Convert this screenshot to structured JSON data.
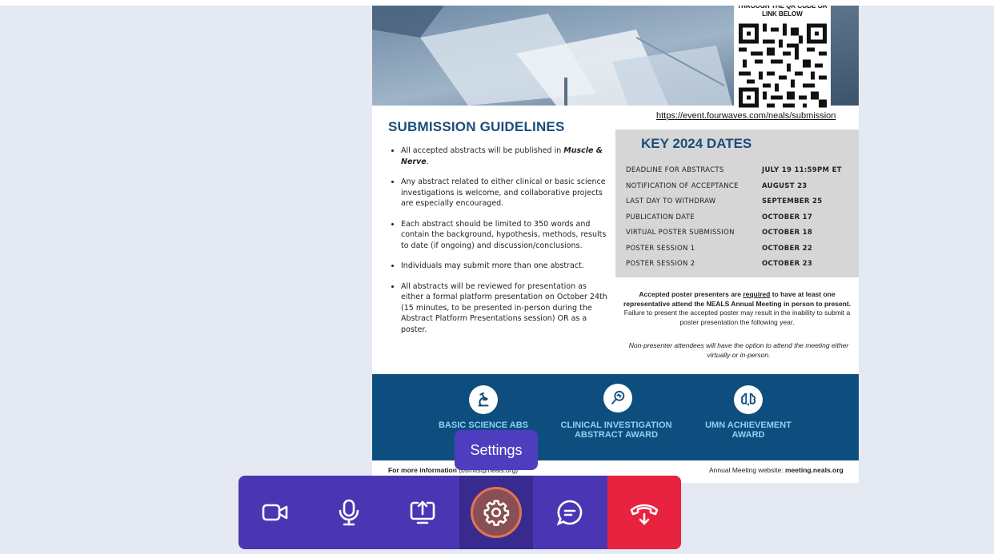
{
  "flyer": {
    "qr_caption": "THROUGH THE QR CODE OR LINK BELOW",
    "submission_link": "https://event.fourwaves.com/neals/submission",
    "guidelines_title": "SUBMISSION GUIDELINES",
    "guidelines": [
      {
        "text": "All accepted abstracts will be published in ",
        "emphasis": "Muscle & Nerve",
        "after": "."
      },
      {
        "text": "Any abstract related to either clinical or basic science investigations is welcome, and collaborative projects are especially encouraged."
      },
      {
        "text": "Each abstract should be limited to 350 words and contain the background, hypothesis, methods, results to date (if ongoing) and discussion/conclusions."
      },
      {
        "text": "Individuals may submit more than one abstract."
      },
      {
        "text": "All abstracts will be reviewed for presentation as either a formal platform presentation on October 24th (15 minutes, to be presented in-person during the Abstract Platform Presentations session) OR as a poster."
      }
    ],
    "dates_title": "KEY 2024 DATES",
    "dates": [
      {
        "label": "DEADLINE FOR ABSTRACTS",
        "value": "JULY 19 11:59PM ET"
      },
      {
        "label": "NOTIFICATION OF ACCEPTANCE",
        "value": "AUGUST 23"
      },
      {
        "label": "LAST DAY TO WITHDRAW",
        "value": "SEPTEMBER 25"
      },
      {
        "label": "PUBLICATION DATE",
        "value": "OCTOBER 17"
      },
      {
        "label": "VIRTUAL POSTER SUBMISSION",
        "value": "OCTOBER 18"
      },
      {
        "label": "POSTER SESSION 1",
        "value": "OCTOBER 22"
      },
      {
        "label": "POSTER SESSION 2",
        "value": "OCTOBER 23"
      }
    ],
    "poster_note_bold": "Accepted poster presenters are ",
    "poster_note_required": "required",
    "poster_note_bold2": " to have at least one representative attend the NEALS Annual Meeting in person to present.",
    "poster_note_rest": " Failure to present the accepted poster may result in the inability to submit a poster presentation the following year.",
    "non_presenter_note": "Non-presenter attendees will have the option to attend the meeting either virtually or in-person.",
    "awards": [
      {
        "label": "BASIC SCIENCE ABS",
        "icon": "microscope-icon"
      },
      {
        "label": "CLINICAL INVESTIGATION ABSTRACT AWARD",
        "icon": "magnifier-icon"
      },
      {
        "label": "UMN ACHIEVEMENT AWARD",
        "icon": "brain-icon"
      }
    ],
    "footer_left_prefix": "For more information",
    "footer_left_suffix": "(bsmits@neals.org)",
    "footer_right_prefix": "Annual Meeting website: ",
    "footer_right_site": "meeting.neals.org"
  },
  "tooltip": "Settings",
  "toolbar": {
    "buttons": [
      {
        "name": "camera",
        "icon": "video-camera-icon"
      },
      {
        "name": "microphone",
        "icon": "microphone-icon"
      },
      {
        "name": "share-screen",
        "icon": "screen-share-icon"
      },
      {
        "name": "settings",
        "icon": "gear-icon",
        "active": true
      },
      {
        "name": "chat",
        "icon": "chat-bubble-icon"
      },
      {
        "name": "hang-up",
        "icon": "phone-hangup-icon"
      }
    ]
  },
  "colors": {
    "toolbar": "#4a36b3",
    "toolbar_active": "#392a90",
    "hangup": "#e8233f",
    "flyer_blue": "#0e4e7e",
    "title_blue": "#1d4d7a",
    "award_text": "#8fd0f5"
  }
}
